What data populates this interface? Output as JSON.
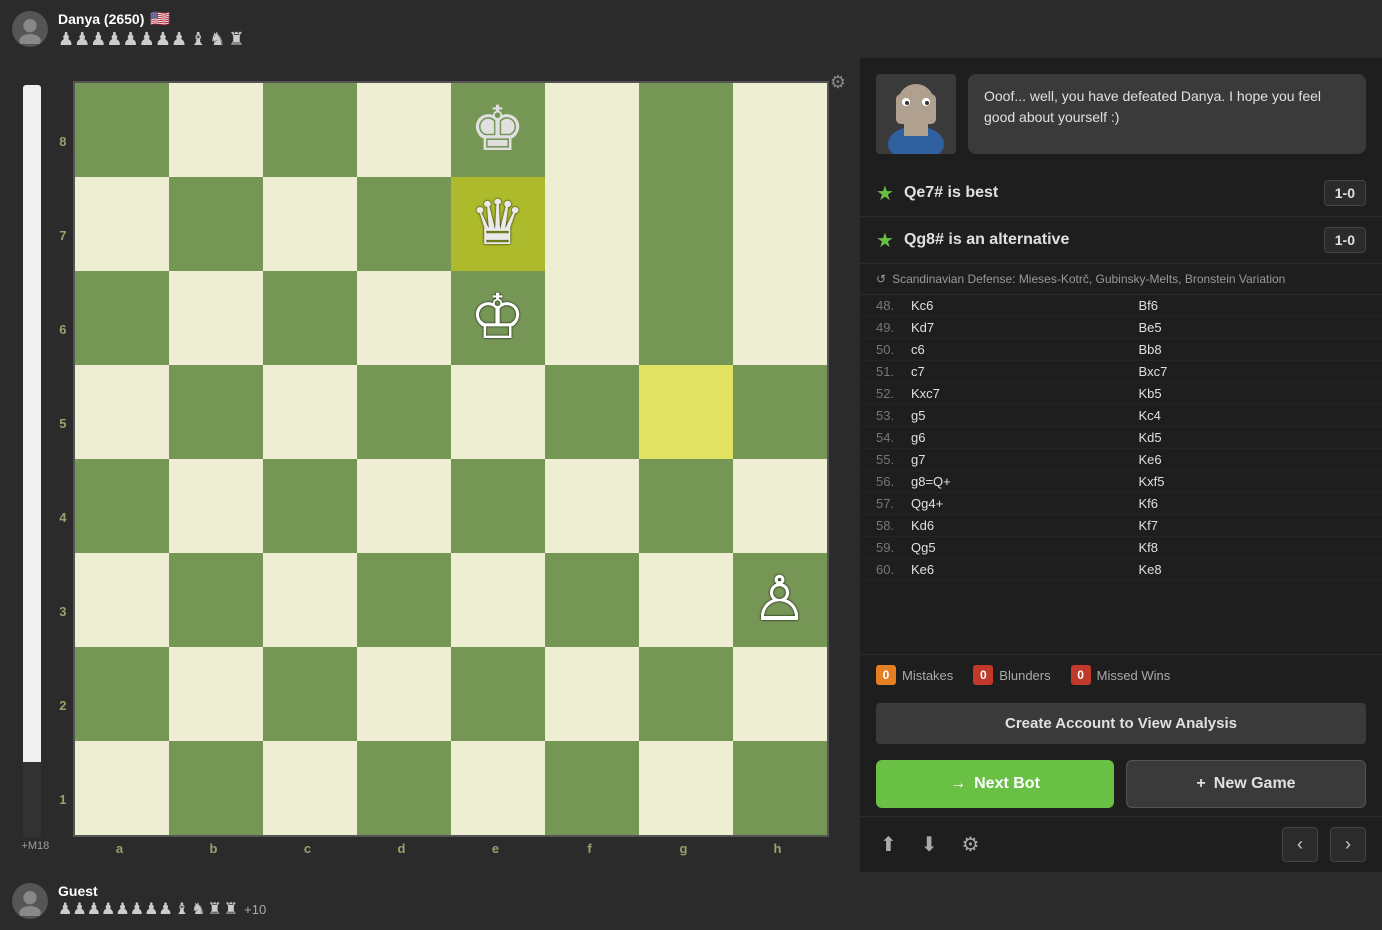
{
  "top_player": {
    "name": "Danya (2650)",
    "flag": "🇺🇸",
    "pieces": "♟♟♟♟♟♟♟♟ ♝ ♞ ♜"
  },
  "bottom_player": {
    "name": "Guest",
    "pieces": "♟♟♟♟♟♟♟♟ ♝ ♞ ♜ ♜",
    "extra": "+10"
  },
  "chat": {
    "message": "Ooof... well, you have defeated Danya. I hope you feel good about yourself :)"
  },
  "suggestions": [
    {
      "move": "Qe7# is best",
      "score": "1-0"
    },
    {
      "move": "Qg8# is an alternative",
      "score": "1-0"
    }
  ],
  "opening": "Scandinavian Defense: Mieses-Kotrč, Gubinsky-Melts, Bronstein Variation",
  "moves": [
    {
      "num": "48.",
      "white": "Kc6",
      "black": "Bf6"
    },
    {
      "num": "49.",
      "white": "Kd7",
      "black": "Be5"
    },
    {
      "num": "50.",
      "white": "c6",
      "black": "Bb8"
    },
    {
      "num": "51.",
      "white": "c7",
      "black": "Bxc7"
    },
    {
      "num": "52.",
      "white": "Kxc7",
      "black": "Kb5"
    },
    {
      "num": "53.",
      "white": "g5",
      "black": "Kc4"
    },
    {
      "num": "54.",
      "white": "g6",
      "black": "Kd5"
    },
    {
      "num": "55.",
      "white": "g7",
      "black": "Ke6"
    },
    {
      "num": "56.",
      "white": "g8=Q+",
      "black": "Kxf5"
    },
    {
      "num": "57.",
      "white": "Qg4+",
      "black": "Kf6"
    },
    {
      "num": "58.",
      "white": "Kd6",
      "black": "Kf7"
    },
    {
      "num": "59.",
      "white": "Qg5",
      "black": "Kf8"
    },
    {
      "num": "60.",
      "white": "Ke6",
      "black": "Ke8"
    }
  ],
  "stats": {
    "mistakes": {
      "count": "0",
      "label": "Mistakes"
    },
    "blunders": {
      "count": "0",
      "label": "Blunders"
    },
    "missed_wins": {
      "count": "0",
      "label": "Missed Wins"
    }
  },
  "buttons": {
    "analysis": "Create Account to View Analysis",
    "next_bot": "Next Bot",
    "new_game": "New Game"
  },
  "eval": "+M18",
  "board": {
    "files": [
      "a",
      "b",
      "c",
      "d",
      "e",
      "f",
      "g",
      "h"
    ],
    "ranks": [
      "8",
      "7",
      "6",
      "5",
      "4",
      "3",
      "2",
      "1"
    ]
  }
}
